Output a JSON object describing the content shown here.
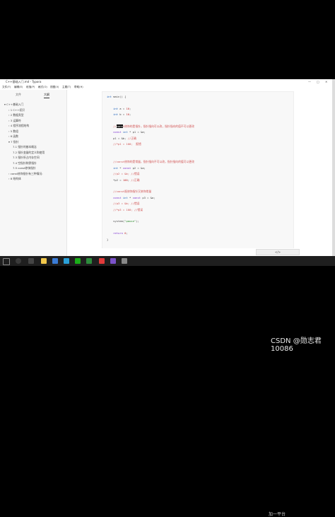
{
  "window": {
    "title": "C++基础入门.md - Typora",
    "controls": [
      "—",
      "□",
      "✕"
    ]
  },
  "menubar": [
    "文件(F)",
    "编辑(E)",
    "段落(P)",
    "格式(O)",
    "视图(V)",
    "主题(T)",
    "帮助(H)"
  ],
  "sidebar": {
    "tabs": [
      "文件",
      "大纲"
    ],
    "active_tab": "大纲",
    "outline": [
      {
        "label": "C++基础入门",
        "level": 0,
        "expanded": true
      },
      {
        "label": "1 C++初识",
        "level": 1
      },
      {
        "label": "2 数据类型",
        "level": 1
      },
      {
        "label": "3 运算符",
        "level": 1
      },
      {
        "label": "4 程序流程结构",
        "level": 1
      },
      {
        "label": "5 数组",
        "level": 1
      },
      {
        "label": "6 函数",
        "level": 1
      },
      {
        "label": "7 指针",
        "level": 1,
        "expanded": true
      },
      {
        "label": "7.1 指针的基本概念",
        "level": 2
      },
      {
        "label": "7.2 指针变量的定义和使用",
        "level": 2
      },
      {
        "label": "7.3 指针所占内存空间",
        "level": 2
      },
      {
        "label": "7.4 空指针和野指针",
        "level": 2
      },
      {
        "label": "7.5 const修饰指针",
        "level": 2
      },
      {
        "label": "const修饰指针有三种情况:",
        "level": 1
      },
      {
        "label": "8 结构体",
        "level": 1
      }
    ]
  },
  "code": {
    "lines": [
      {
        "parts": [
          {
            "t": "int",
            "c": "ty"
          },
          {
            "t": " main() {",
            "c": ""
          }
        ]
      },
      {
        "parts": []
      },
      {
        "parts": [
          {
            "t": "    int",
            "c": "ty"
          },
          {
            "t": " a = ",
            "c": ""
          },
          {
            "t": "10",
            "c": "num"
          },
          {
            "t": ";",
            "c": ""
          }
        ]
      },
      {
        "parts": [
          {
            "t": "    int",
            "c": "ty"
          },
          {
            "t": " b = ",
            "c": ""
          },
          {
            "t": "10",
            "c": "num"
          },
          {
            "t": ";",
            "c": ""
          }
        ]
      },
      {
        "parts": []
      },
      {
        "parts": [
          {
            "t": "    //",
            "c": "cm"
          },
          {
            "t": "cons",
            "c": "cursorbox"
          },
          {
            "t": "t修饰的是指针，指针指向可以改，指针指向的值不可以更改",
            "c": "cm"
          }
        ]
      },
      {
        "parts": [
          {
            "t": "    const",
            "c": "kw"
          },
          {
            "t": " ",
            "c": ""
          },
          {
            "t": "int",
            "c": "ty"
          },
          {
            "t": " * p1 = &a;",
            "c": ""
          }
        ]
      },
      {
        "parts": [
          {
            "t": "    p1 = &b; ",
            "c": ""
          },
          {
            "t": "//正确",
            "c": "cm"
          }
        ]
      },
      {
        "parts": [
          {
            "t": "    //*p1 = 100;  报错",
            "c": "cm"
          }
        ]
      },
      {
        "parts": []
      },
      {
        "parts": []
      },
      {
        "parts": [
          {
            "t": "    //const修饰的是常量，指针指向不可以改，指针指向的值可以更改",
            "c": "cm"
          }
        ]
      },
      {
        "parts": [
          {
            "t": "    int",
            "c": "ty"
          },
          {
            "t": " * ",
            "c": ""
          },
          {
            "t": "const",
            "c": "kw"
          },
          {
            "t": " p2 = &a;",
            "c": ""
          }
        ]
      },
      {
        "parts": [
          {
            "t": "    //p2 = &b; //错误",
            "c": "cm"
          }
        ]
      },
      {
        "parts": [
          {
            "t": "    *p2 = ",
            "c": ""
          },
          {
            "t": "100",
            "c": "num"
          },
          {
            "t": "; ",
            "c": ""
          },
          {
            "t": "//正确",
            "c": "cm"
          }
        ]
      },
      {
        "parts": []
      },
      {
        "parts": [
          {
            "t": "    //const既修饰指针又修饰常量",
            "c": "cm"
          }
        ]
      },
      {
        "parts": [
          {
            "t": "    const",
            "c": "kw"
          },
          {
            "t": " ",
            "c": ""
          },
          {
            "t": "int",
            "c": "ty"
          },
          {
            "t": " * ",
            "c": ""
          },
          {
            "t": "const",
            "c": "kw"
          },
          {
            "t": " p3 = &a;",
            "c": ""
          }
        ]
      },
      {
        "parts": [
          {
            "t": "    //p3 = &b; //错误",
            "c": "cm"
          }
        ]
      },
      {
        "parts": [
          {
            "t": "    //*p3 = 100; //错误",
            "c": "cm"
          }
        ]
      },
      {
        "parts": []
      },
      {
        "parts": [
          {
            "t": "    system(",
            "c": ""
          },
          {
            "t": "\"pause\"",
            "c": "str"
          },
          {
            "t": ");",
            "c": ""
          }
        ]
      },
      {
        "parts": []
      },
      {
        "parts": [
          {
            "t": "    return",
            "c": "kw"
          },
          {
            "t": " ",
            "c": ""
          },
          {
            "t": "0",
            "c": "num"
          },
          {
            "t": ";",
            "c": ""
          }
        ]
      },
      {
        "parts": [
          {
            "t": "}",
            "c": ""
          }
        ]
      }
    ]
  },
  "bottom": {
    "button_label": "</>"
  },
  "overlay_text": "加一平台 ",
  "watermark": "CSDN @勋志君10086",
  "colors": {
    "keyword": "#7b30d0",
    "type": "#1b5fb8",
    "comment": "#d05050",
    "number": "#c02d2d"
  }
}
